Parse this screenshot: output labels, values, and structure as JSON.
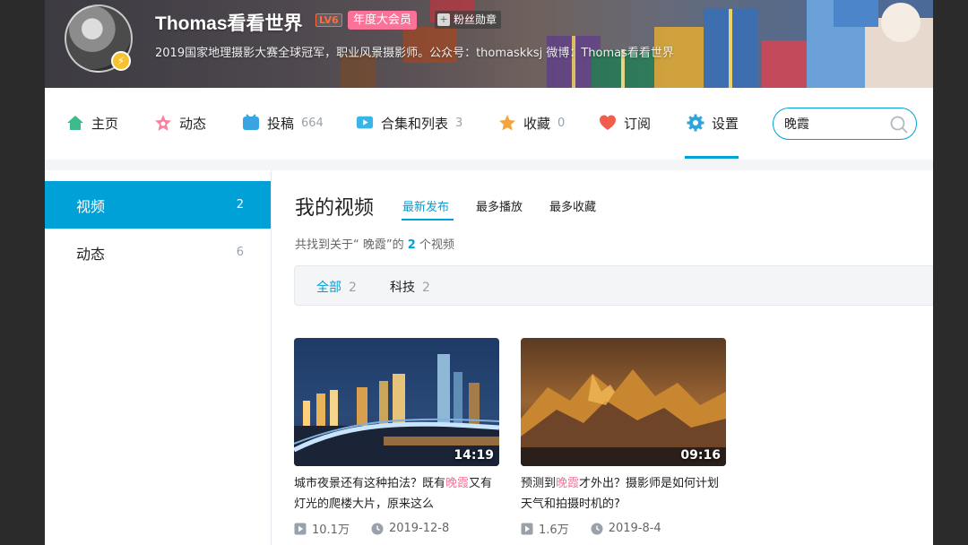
{
  "profile": {
    "name": "Thomas看看世界",
    "level": "LV6",
    "vip_badge": "年度大会员",
    "fan_medal": "粉丝勋章",
    "signature": "2019国家地理摄影大赛全球冠军，职业风景摄影师。公众号：thomaskksj 微博：Thomas看看世界"
  },
  "nav": {
    "items": [
      {
        "label": "主页",
        "count": ""
      },
      {
        "label": "动态",
        "count": ""
      },
      {
        "label": "投稿",
        "count": "664"
      },
      {
        "label": "合集和列表",
        "count": "3"
      },
      {
        "label": "收藏",
        "count": "0"
      },
      {
        "label": "订阅",
        "count": ""
      },
      {
        "label": "设置",
        "count": ""
      }
    ],
    "search_value": "晚霞"
  },
  "sidebar": {
    "items": [
      {
        "label": "视频",
        "count": "2"
      },
      {
        "label": "动态",
        "count": "6"
      }
    ]
  },
  "main": {
    "title": "我的视频",
    "sort_tabs": [
      "最新发布",
      "最多播放",
      "最多收藏"
    ],
    "result": {
      "prefix": "共找到关于“ 晚霞”的",
      "count": "2",
      "suffix": "个视频"
    },
    "filters": [
      {
        "label": "全部",
        "count": "2"
      },
      {
        "label": "科技",
        "count": "2"
      }
    ]
  },
  "videos": [
    {
      "duration": "14:19",
      "title_before": "城市夜景还有这种拍法？既有",
      "title_highlight": "晚霞",
      "title_after": "又有灯光的爬楼大片，原来这么",
      "views": "10.1万",
      "date": "2019-12-8"
    },
    {
      "duration": "09:16",
      "title_before": "预测到",
      "title_highlight": "晚霞",
      "title_after": "才外出？摄影师是如何计划天气和拍摄时机的?",
      "views": "1.6万",
      "date": "2019-8-4"
    }
  ],
  "colors": {
    "accent": "#00a1d6",
    "pink": "#fb7299"
  }
}
